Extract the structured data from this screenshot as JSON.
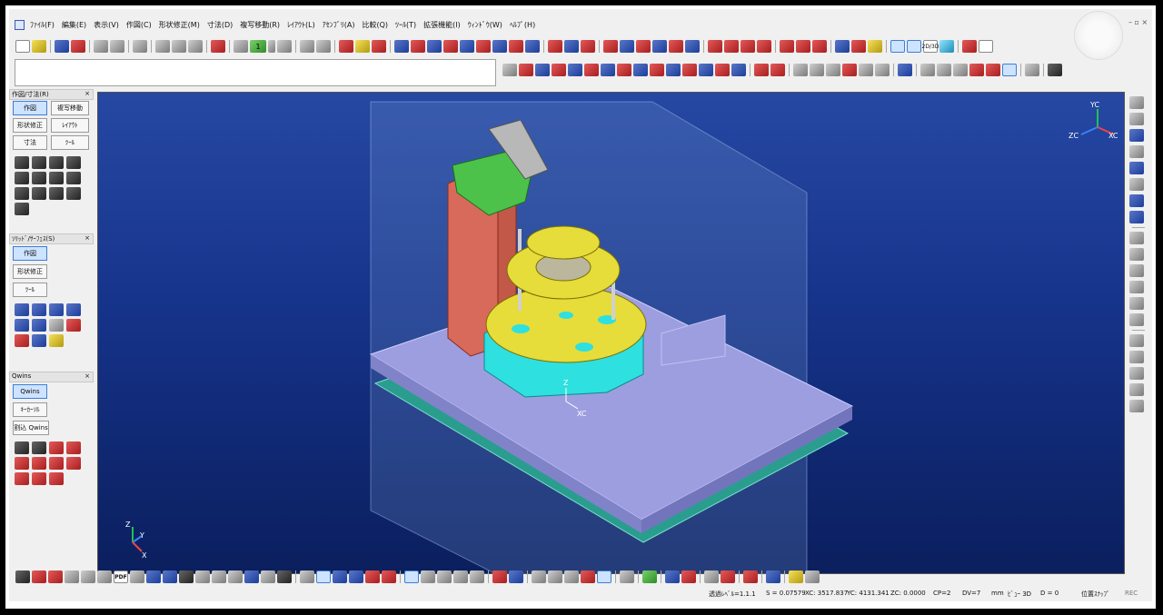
{
  "menu": [
    "ﾌｧｲﾙ(F)",
    "編集(E)",
    "表示(V)",
    "作図(C)",
    "形状修正(M)",
    "寸法(D)",
    "複写移動(R)",
    "ﾚｲｱｳﾄ(L)",
    "ｱｾﾝﾌﾞﾘ(A)",
    "比較(Q)",
    "ﾂｰﾙ(T)",
    "拡張機能(I)",
    "ｳｨﾝﾄﾞｳ(W)",
    "ﾍﾙﾌﾟ(H)"
  ],
  "toolbar": {
    "layer_value": "1",
    "pdf_label": "PDF",
    "view2d3d": "2D/3D"
  },
  "panels": {
    "drawing": {
      "title": "作図/寸法(R)",
      "close": "×",
      "buttons": [
        "作図",
        "複写移動",
        "形状修正",
        "ﾚｲｱｳﾄ",
        "寸法",
        "ﾂｰﾙ"
      ]
    },
    "solid": {
      "title": "ｿﾘｯﾄﾞ/ｻｰﾌｪｽ(S)",
      "close": "×",
      "buttons": [
        "作図",
        "形状修正",
        "ﾂｰﾙ"
      ]
    },
    "qwins": {
      "title": "Qwins",
      "close": "×",
      "buttons": [
        "Qwins",
        "ｷｰｶｰｿﾙ",
        "割込 Qwins"
      ]
    }
  },
  "triad": {
    "yc": "YC",
    "zc": "ZC",
    "xc": "XC",
    "origin_z": "Z",
    "origin_x": "XC",
    "corner_z": "Z",
    "corner_y": "Y",
    "corner_x": "X"
  },
  "status": {
    "layer": "透過ﾚﾍﾞﾙ=1.1.1",
    "scale": "S = 0.07579",
    "xc": "XC: 3517.837",
    "yc": "YC: 4131.341",
    "zc": "ZC: 0.0000",
    "cp": "CP=2",
    "dv": "DV=7",
    "unit": "mm",
    "view": "ﾋﾞｭｰ 3D",
    "d": "D = 0",
    "snap": "位置ｽﾅｯﾌﾟ",
    "rec": "REC"
  },
  "colors": {
    "viewport_top": "#2648a3",
    "viewport_bottom": "#0b1f5e",
    "plate": "#9d9ee0",
    "yellow": "#e6dc3a",
    "red": "#d76a5a",
    "cyan": "#2ee0e0"
  }
}
